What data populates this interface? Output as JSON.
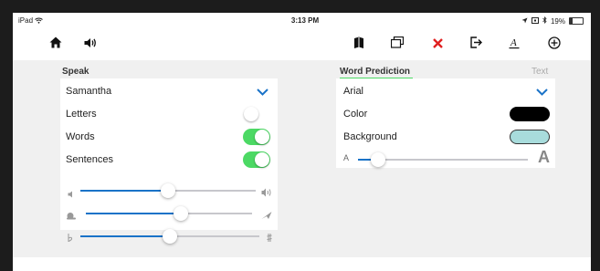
{
  "statusbar": {
    "device": "iPad",
    "time": "3:13 PM",
    "battery": "19%"
  },
  "toolbar": {
    "left": [
      {
        "icon": "home-icon"
      },
      {
        "icon": "speaker-icon"
      }
    ],
    "right": [
      {
        "icon": "book-icon"
      },
      {
        "icon": "windows-icon"
      },
      {
        "icon": "close-icon"
      },
      {
        "icon": "exit-icon"
      },
      {
        "icon": "text-style-icon"
      },
      {
        "icon": "add-circle-icon"
      }
    ]
  },
  "speak": {
    "title": "Speak",
    "voice": "Samantha",
    "rows": [
      {
        "label": "Letters",
        "on": false
      },
      {
        "label": "Words",
        "on": true
      },
      {
        "label": "Sentences",
        "on": true
      }
    ],
    "sliders": [
      {
        "name": "volume",
        "value": 0.5
      },
      {
        "name": "speed",
        "value": 0.57
      },
      {
        "name": "pitch",
        "value": 0.5
      }
    ]
  },
  "prediction": {
    "tab_active": "Word Prediction",
    "tab_inactive": "Text",
    "font": "Arial",
    "color_label": "Color",
    "color_value": "#000000",
    "background_label": "Background",
    "background_value": "#a8dcdc",
    "size_small": "A",
    "size_large": "A",
    "size_value": 0.12
  },
  "colors": {
    "accent": "#1a73c8",
    "toggle_on": "#4cd964",
    "close": "#e02020",
    "underline": "#4cd964"
  }
}
